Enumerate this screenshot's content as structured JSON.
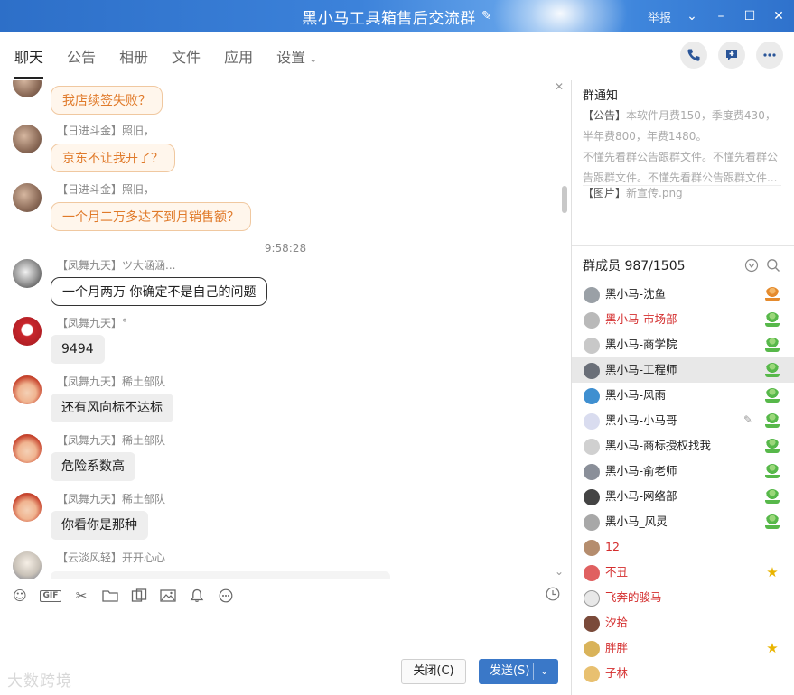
{
  "window": {
    "title": "黑小马工具箱售后交流群",
    "report": "举报"
  },
  "tabs": [
    "聊天",
    "公告",
    "相册",
    "文件",
    "应用",
    "设置"
  ],
  "chat": {
    "time": "9:58:28",
    "messages": [
      {
        "name": "",
        "text": "我店续签失败？"
      },
      {
        "name": "【日进斗金】照旧，",
        "text": "京东不让我开了？"
      },
      {
        "name": "【日进斗金】照旧，",
        "text": "一个月二万多达不到月销售额？"
      },
      {
        "name": "【凤舞九天】ツ大涵涵...",
        "text": "一个月两万 你确定不是自己的问题"
      },
      {
        "name": "【凤舞九天】°",
        "text": "9494"
      },
      {
        "name": "【凤舞九天】稀土部队",
        "text": "还有风向标不达标"
      },
      {
        "name": "【凤舞九天】稀土部队",
        "text": "危险系数高"
      },
      {
        "name": "【凤舞九天】稀土部队",
        "text": "你看你是那种"
      },
      {
        "name": "【云淡风轻】开开心心",
        "text": ""
      }
    ]
  },
  "toolbar": {
    "gif": "GIF"
  },
  "buttons": {
    "close": "关闭(C)",
    "send": "发送(S)"
  },
  "watermark": "大数跨境",
  "notice": {
    "title": "群通知",
    "tag1": "【公告】",
    "text1": "本软件月费150，季度费430，半年费800，年费1480。",
    "text2": "不懂先看群公告跟群文件。不懂先看群公告跟群文件。不懂先看群公告跟群文件...",
    "tag2": "【图片】",
    "img": "新宣传.png"
  },
  "members": {
    "header": "群成员 987/1505",
    "list": [
      {
        "name": "黑小马-沈鱼",
        "red": false,
        "badge": "orange"
      },
      {
        "name": "黑小马-市场部",
        "red": true,
        "badge": "green"
      },
      {
        "name": "黑小马-商学院",
        "red": false,
        "badge": "green"
      },
      {
        "name": "黑小马-工程师",
        "red": false,
        "badge": "green"
      },
      {
        "name": "黑小马-风雨",
        "red": false,
        "badge": "green"
      },
      {
        "name": "黑小马-小马哥",
        "red": false,
        "badge": "green"
      },
      {
        "name": "黑小马-商标授权找我",
        "red": false,
        "badge": "green"
      },
      {
        "name": "黑小马-俞老师",
        "red": false,
        "badge": "green"
      },
      {
        "name": "黑小马-网络部",
        "red": false,
        "badge": "green"
      },
      {
        "name": "黑小马_风灵",
        "red": false,
        "badge": "green"
      },
      {
        "name": "12",
        "red": true,
        "badge": ""
      },
      {
        "name": "不丑",
        "red": true,
        "badge": "star"
      },
      {
        "name": "飞奔的骏马",
        "red": true,
        "badge": ""
      },
      {
        "name": "汐拾",
        "red": true,
        "badge": ""
      },
      {
        "name": "胖胖",
        "red": true,
        "badge": "star"
      },
      {
        "name": "子林",
        "red": true,
        "badge": ""
      }
    ]
  },
  "colors": {
    "title_bar": "#3c82da",
    "send_button": "#3a78c8",
    "orange_bubble_text": "#e07a2a",
    "red_name": "#d42d2d"
  }
}
